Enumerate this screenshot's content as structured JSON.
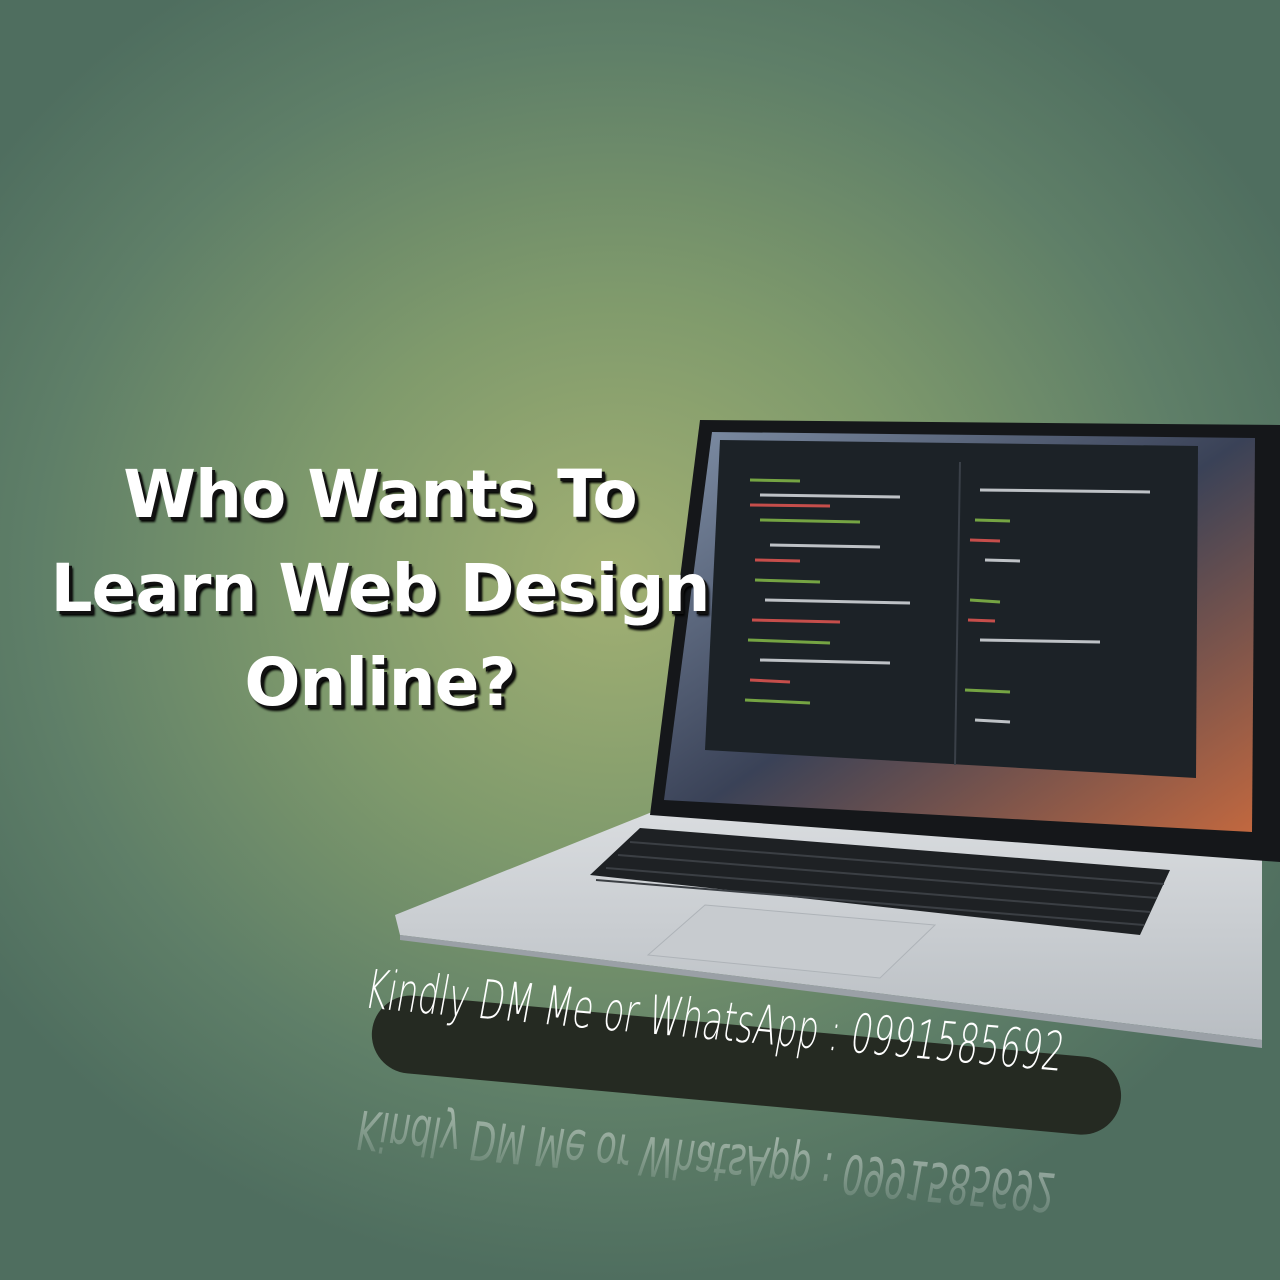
{
  "headline": {
    "line1": "Who Wants To",
    "line2": "Learn Web Design",
    "line3": "Online?"
  },
  "contact_banner": {
    "text": "Kindly DM Me or WhatsApp : 0991585692"
  },
  "colors": {
    "background_center": "#a2b073",
    "background_edge": "#4f6e5f",
    "banner": "#252a22",
    "text": "#ffffff"
  },
  "image": {
    "subject": "laptop-with-code-editor"
  }
}
